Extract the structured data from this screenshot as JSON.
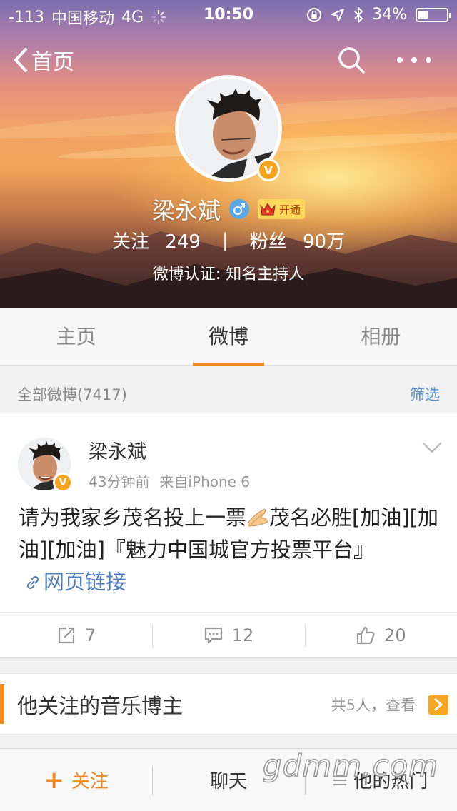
{
  "status_bar": {
    "signal": "-113",
    "carrier": "中国移动",
    "network": "4G",
    "time": "10:50",
    "battery_percent": "34%",
    "battery_level": 0.34
  },
  "nav": {
    "back_label": "首页"
  },
  "profile": {
    "name": "梁永斌",
    "vip_label": "开通",
    "following_label": "关注",
    "following_count": "249",
    "followers_label": "粉丝",
    "followers_count": "90万",
    "verification": "微博认证: 知名主持人",
    "verified_badge": "V"
  },
  "tabs": [
    {
      "label": "主页",
      "active": false
    },
    {
      "label": "微博",
      "active": true
    },
    {
      "label": "相册",
      "active": false
    }
  ],
  "filter": {
    "all_posts_label": "全部微博(7417)",
    "filter_link": "筛选"
  },
  "post": {
    "author": "梁永斌",
    "time": "43分钟前",
    "source": "来自iPhone 6",
    "text_part1": "请为我家乡茂名投上一票",
    "text_part2": "茂名必胜[加油][加油][加油]『魅力中国城官方投票平台』",
    "link_label": "网页链接",
    "reposts": "7",
    "comments": "12",
    "likes": "20"
  },
  "section": {
    "title": "他关注的音乐博主",
    "right_text": "共5人，查看"
  },
  "toolbar": {
    "follow_label": "关注",
    "chat_label": "聊天",
    "hot_label": "他的热门"
  },
  "watermark": "gdmm.com",
  "colors": {
    "accent": "#f08a24",
    "link": "#4f7fbf",
    "verified": "#f7a41c"
  }
}
